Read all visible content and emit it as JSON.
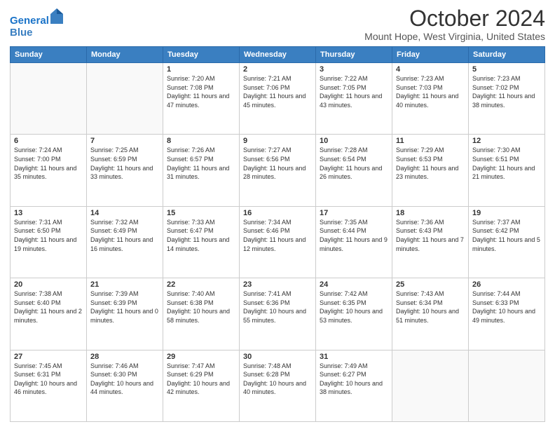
{
  "header": {
    "logo_line1": "General",
    "logo_line2": "Blue",
    "title": "October 2024",
    "subtitle": "Mount Hope, West Virginia, United States"
  },
  "calendar": {
    "days_of_week": [
      "Sunday",
      "Monday",
      "Tuesday",
      "Wednesday",
      "Thursday",
      "Friday",
      "Saturday"
    ],
    "weeks": [
      [
        {
          "day": "",
          "info": ""
        },
        {
          "day": "",
          "info": ""
        },
        {
          "day": "1",
          "info": "Sunrise: 7:20 AM\nSunset: 7:08 PM\nDaylight: 11 hours and 47 minutes."
        },
        {
          "day": "2",
          "info": "Sunrise: 7:21 AM\nSunset: 7:06 PM\nDaylight: 11 hours and 45 minutes."
        },
        {
          "day": "3",
          "info": "Sunrise: 7:22 AM\nSunset: 7:05 PM\nDaylight: 11 hours and 43 minutes."
        },
        {
          "day": "4",
          "info": "Sunrise: 7:23 AM\nSunset: 7:03 PM\nDaylight: 11 hours and 40 minutes."
        },
        {
          "day": "5",
          "info": "Sunrise: 7:23 AM\nSunset: 7:02 PM\nDaylight: 11 hours and 38 minutes."
        }
      ],
      [
        {
          "day": "6",
          "info": "Sunrise: 7:24 AM\nSunset: 7:00 PM\nDaylight: 11 hours and 35 minutes."
        },
        {
          "day": "7",
          "info": "Sunrise: 7:25 AM\nSunset: 6:59 PM\nDaylight: 11 hours and 33 minutes."
        },
        {
          "day": "8",
          "info": "Sunrise: 7:26 AM\nSunset: 6:57 PM\nDaylight: 11 hours and 31 minutes."
        },
        {
          "day": "9",
          "info": "Sunrise: 7:27 AM\nSunset: 6:56 PM\nDaylight: 11 hours and 28 minutes."
        },
        {
          "day": "10",
          "info": "Sunrise: 7:28 AM\nSunset: 6:54 PM\nDaylight: 11 hours and 26 minutes."
        },
        {
          "day": "11",
          "info": "Sunrise: 7:29 AM\nSunset: 6:53 PM\nDaylight: 11 hours and 23 minutes."
        },
        {
          "day": "12",
          "info": "Sunrise: 7:30 AM\nSunset: 6:51 PM\nDaylight: 11 hours and 21 minutes."
        }
      ],
      [
        {
          "day": "13",
          "info": "Sunrise: 7:31 AM\nSunset: 6:50 PM\nDaylight: 11 hours and 19 minutes."
        },
        {
          "day": "14",
          "info": "Sunrise: 7:32 AM\nSunset: 6:49 PM\nDaylight: 11 hours and 16 minutes."
        },
        {
          "day": "15",
          "info": "Sunrise: 7:33 AM\nSunset: 6:47 PM\nDaylight: 11 hours and 14 minutes."
        },
        {
          "day": "16",
          "info": "Sunrise: 7:34 AM\nSunset: 6:46 PM\nDaylight: 11 hours and 12 minutes."
        },
        {
          "day": "17",
          "info": "Sunrise: 7:35 AM\nSunset: 6:44 PM\nDaylight: 11 hours and 9 minutes."
        },
        {
          "day": "18",
          "info": "Sunrise: 7:36 AM\nSunset: 6:43 PM\nDaylight: 11 hours and 7 minutes."
        },
        {
          "day": "19",
          "info": "Sunrise: 7:37 AM\nSunset: 6:42 PM\nDaylight: 11 hours and 5 minutes."
        }
      ],
      [
        {
          "day": "20",
          "info": "Sunrise: 7:38 AM\nSunset: 6:40 PM\nDaylight: 11 hours and 2 minutes."
        },
        {
          "day": "21",
          "info": "Sunrise: 7:39 AM\nSunset: 6:39 PM\nDaylight: 11 hours and 0 minutes."
        },
        {
          "day": "22",
          "info": "Sunrise: 7:40 AM\nSunset: 6:38 PM\nDaylight: 10 hours and 58 minutes."
        },
        {
          "day": "23",
          "info": "Sunrise: 7:41 AM\nSunset: 6:36 PM\nDaylight: 10 hours and 55 minutes."
        },
        {
          "day": "24",
          "info": "Sunrise: 7:42 AM\nSunset: 6:35 PM\nDaylight: 10 hours and 53 minutes."
        },
        {
          "day": "25",
          "info": "Sunrise: 7:43 AM\nSunset: 6:34 PM\nDaylight: 10 hours and 51 minutes."
        },
        {
          "day": "26",
          "info": "Sunrise: 7:44 AM\nSunset: 6:33 PM\nDaylight: 10 hours and 49 minutes."
        }
      ],
      [
        {
          "day": "27",
          "info": "Sunrise: 7:45 AM\nSunset: 6:31 PM\nDaylight: 10 hours and 46 minutes."
        },
        {
          "day": "28",
          "info": "Sunrise: 7:46 AM\nSunset: 6:30 PM\nDaylight: 10 hours and 44 minutes."
        },
        {
          "day": "29",
          "info": "Sunrise: 7:47 AM\nSunset: 6:29 PM\nDaylight: 10 hours and 42 minutes."
        },
        {
          "day": "30",
          "info": "Sunrise: 7:48 AM\nSunset: 6:28 PM\nDaylight: 10 hours and 40 minutes."
        },
        {
          "day": "31",
          "info": "Sunrise: 7:49 AM\nSunset: 6:27 PM\nDaylight: 10 hours and 38 minutes."
        },
        {
          "day": "",
          "info": ""
        },
        {
          "day": "",
          "info": ""
        }
      ]
    ]
  }
}
